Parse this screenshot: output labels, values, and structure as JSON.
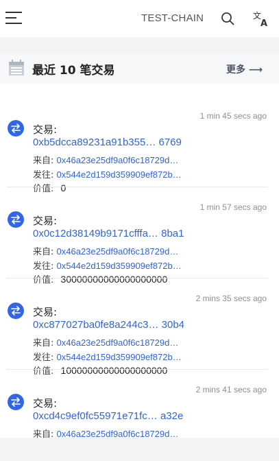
{
  "header": {
    "chain_name": "TEST-CHAIN"
  },
  "section": {
    "title": "最近 10 笔交易",
    "more_label": "更多 ⟶"
  },
  "labels": {
    "tx": "交易:",
    "from": "来自:",
    "to": "发往:",
    "value": "价值:"
  },
  "transactions": [
    {
      "time": "1 min 45 secs ago",
      "hash": "0xb5dcca89231a91b355… 6769",
      "from": "0x46a23e25df9a0f6c18729d…",
      "to": "0x544e2d159d359909ef872b…",
      "value": "0"
    },
    {
      "time": "1 min 57 secs ago",
      "hash": "0x0c12d38149b9171cfffa… 8ba1",
      "from": "0x46a23e25df9a0f6c18729d…",
      "to": "0x544e2d159d359909ef872b…",
      "value": "30000000000000000000"
    },
    {
      "time": "2 mins 35 secs ago",
      "hash": "0xc877027ba0fe8a244c3… 30b4",
      "from": "0x46a23e25df9a0f6c18729d…",
      "to": "0x544e2d159d359909ef872b…",
      "value": "10000000000000000000"
    },
    {
      "time": "2 mins 41 secs ago",
      "hash": "0xcd4c9ef0fc55971e71fc… a32e",
      "from": "0x46a23e25df9a0f6c18729d…",
      "to": "",
      "value": ""
    }
  ]
}
